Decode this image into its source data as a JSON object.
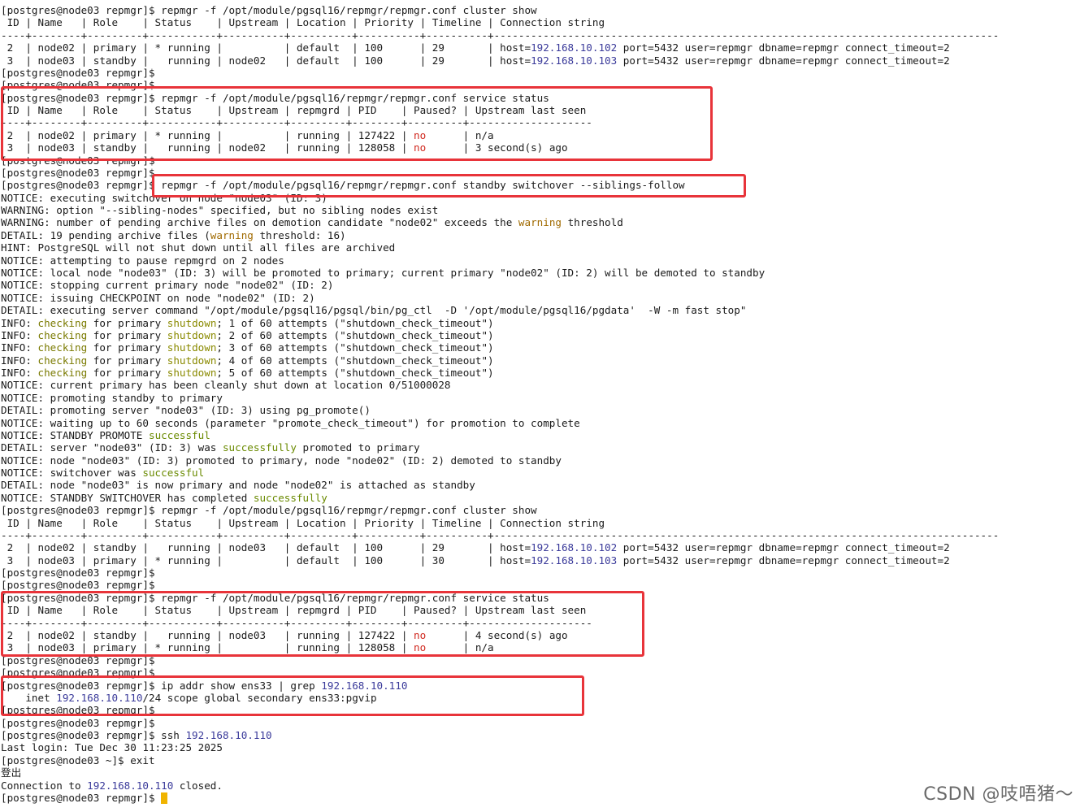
{
  "terminal": {
    "lines": [
      "[postgres@node03 repmgr]$ repmgr -f /opt/module/pgsql16/repmgr/repmgr.conf cluster show",
      " ID | Name   | Role    | Status    | Upstream | Location | Priority | Timeline | Connection string",
      "----+--------+---------+-----------+----------+----------+----------+----------+----------------------------------------------------------------------------------",
      " 2  | node02 | primary | * running |          | default  | 100      | 29       | host=192.168.10.102 port=5432 user=repmgr dbname=repmgr connect_timeout=2",
      " 3  | node03 | standby |   running | node02   | default  | 100      | 29       | host=192.168.10.103 port=5432 user=repmgr dbname=repmgr connect_timeout=2",
      "[postgres@node03 repmgr]$",
      "[postgres@node03 repmgr]$",
      "[postgres@node03 repmgr]$ repmgr -f /opt/module/pgsql16/repmgr/repmgr.conf service status",
      " ID | Name   | Role    | Status    | Upstream | repmgrd | PID    | Paused? | Upstream last seen",
      "----+--------+---------+-----------+----------+---------+--------+---------+--------------------",
      " 2  | node02 | primary | * running |          | running | 127422 | no      | n/a",
      " 3  | node03 | standby |   running | node02   | running | 128058 | no      | 3 second(s) ago",
      "[postgres@node03 repmgr]$",
      "[postgres@node03 repmgr]$",
      "[postgres@node03 repmgr]$ repmgr -f /opt/module/pgsql16/repmgr/repmgr.conf standby switchover --siblings-follow",
      "NOTICE: executing switchover on node \"node03\" (ID: 3)",
      "WARNING: option \"--sibling-nodes\" specified, but no sibling nodes exist",
      "WARNING: number of pending archive files on demotion candidate \"node02\" exceeds the warning threshold",
      "DETAIL: 19 pending archive files (warning threshold: 16)",
      "HINT: PostgreSQL will not shut down until all files are archived",
      "NOTICE: attempting to pause repmgrd on 2 nodes",
      "NOTICE: local node \"node03\" (ID: 3) will be promoted to primary; current primary \"node02\" (ID: 2) will be demoted to standby",
      "NOTICE: stopping current primary node \"node02\" (ID: 2)",
      "NOTICE: issuing CHECKPOINT on node \"node02\" (ID: 2)",
      "DETAIL: executing server command \"/opt/module/pgsql16/pgsql/bin/pg_ctl  -D '/opt/module/pgsql16/pgdata'  -W -m fast stop\"",
      "INFO: checking for primary shutdown; 1 of 60 attempts (\"shutdown_check_timeout\")",
      "INFO: checking for primary shutdown; 2 of 60 attempts (\"shutdown_check_timeout\")",
      "INFO: checking for primary shutdown; 3 of 60 attempts (\"shutdown_check_timeout\")",
      "INFO: checking for primary shutdown; 4 of 60 attempts (\"shutdown_check_timeout\")",
      "INFO: checking for primary shutdown; 5 of 60 attempts (\"shutdown_check_timeout\")",
      "NOTICE: current primary has been cleanly shut down at location 0/51000028",
      "NOTICE: promoting standby to primary",
      "DETAIL: promoting server \"node03\" (ID: 3) using pg_promote()",
      "NOTICE: waiting up to 60 seconds (parameter \"promote_check_timeout\") for promotion to complete",
      "NOTICE: STANDBY PROMOTE successful",
      "DETAIL: server \"node03\" (ID: 3) was successfully promoted to primary",
      "NOTICE: node \"node03\" (ID: 3) promoted to primary, node \"node02\" (ID: 2) demoted to standby",
      "NOTICE: switchover was successful",
      "DETAIL: node \"node03\" is now primary and node \"node02\" is attached as standby",
      "NOTICE: STANDBY SWITCHOVER has completed successfully",
      "[postgres@node03 repmgr]$ repmgr -f /opt/module/pgsql16/repmgr/repmgr.conf cluster show",
      " ID | Name   | Role    | Status    | Upstream | Location | Priority | Timeline | Connection string",
      "----+--------+---------+-----------+----------+----------+----------+----------+----------------------------------------------------------------------------------",
      " 2  | node02 | standby |   running | node03   | default  | 100      | 29       | host=192.168.10.102 port=5432 user=repmgr dbname=repmgr connect_timeout=2",
      " 3  | node03 | primary | * running |          | default  | 100      | 30       | host=192.168.10.103 port=5432 user=repmgr dbname=repmgr connect_timeout=2",
      "[postgres@node03 repmgr]$",
      "[postgres@node03 repmgr]$",
      "[postgres@node03 repmgr]$ repmgr -f /opt/module/pgsql16/repmgr/repmgr.conf service status",
      " ID | Name   | Role    | Status    | Upstream | repmgrd | PID    | Paused? | Upstream last seen",
      "----+--------+---------+-----------+----------+---------+--------+---------+--------------------",
      " 2  | node02 | standby |   running | node03   | running | 127422 | no      | 4 second(s) ago",
      " 3  | node03 | primary | * running |          | running | 128058 | no      | n/a",
      "[postgres@node03 repmgr]$",
      "[postgres@node03 repmgr]$",
      "[postgres@node03 repmgr]$ ip addr show ens33 | grep 192.168.10.110",
      "    inet 192.168.10.110/24 scope global secondary ens33:pgvip",
      "[postgres@node03 repmgr]$",
      "[postgres@node03 repmgr]$",
      "[postgres@node03 repmgr]$ ssh 192.168.10.110",
      "Last login: Tue Dec 30 11:23:25 2025",
      "[postgres@node03 ~]$ exit",
      "登出",
      "Connection to 192.168.10.110 closed.",
      "[postgres@node03 repmgr]$ "
    ],
    "highlight_words": [
      "checking",
      "shutdown",
      "successful",
      "successfully",
      "warning"
    ],
    "colors": {
      "background": "#ffffff",
      "text": "#1a1a1a",
      "highlight_box": "#e8343a",
      "cursor": "#f0b400"
    }
  },
  "watermark": "CSDN @吱唔猪～"
}
